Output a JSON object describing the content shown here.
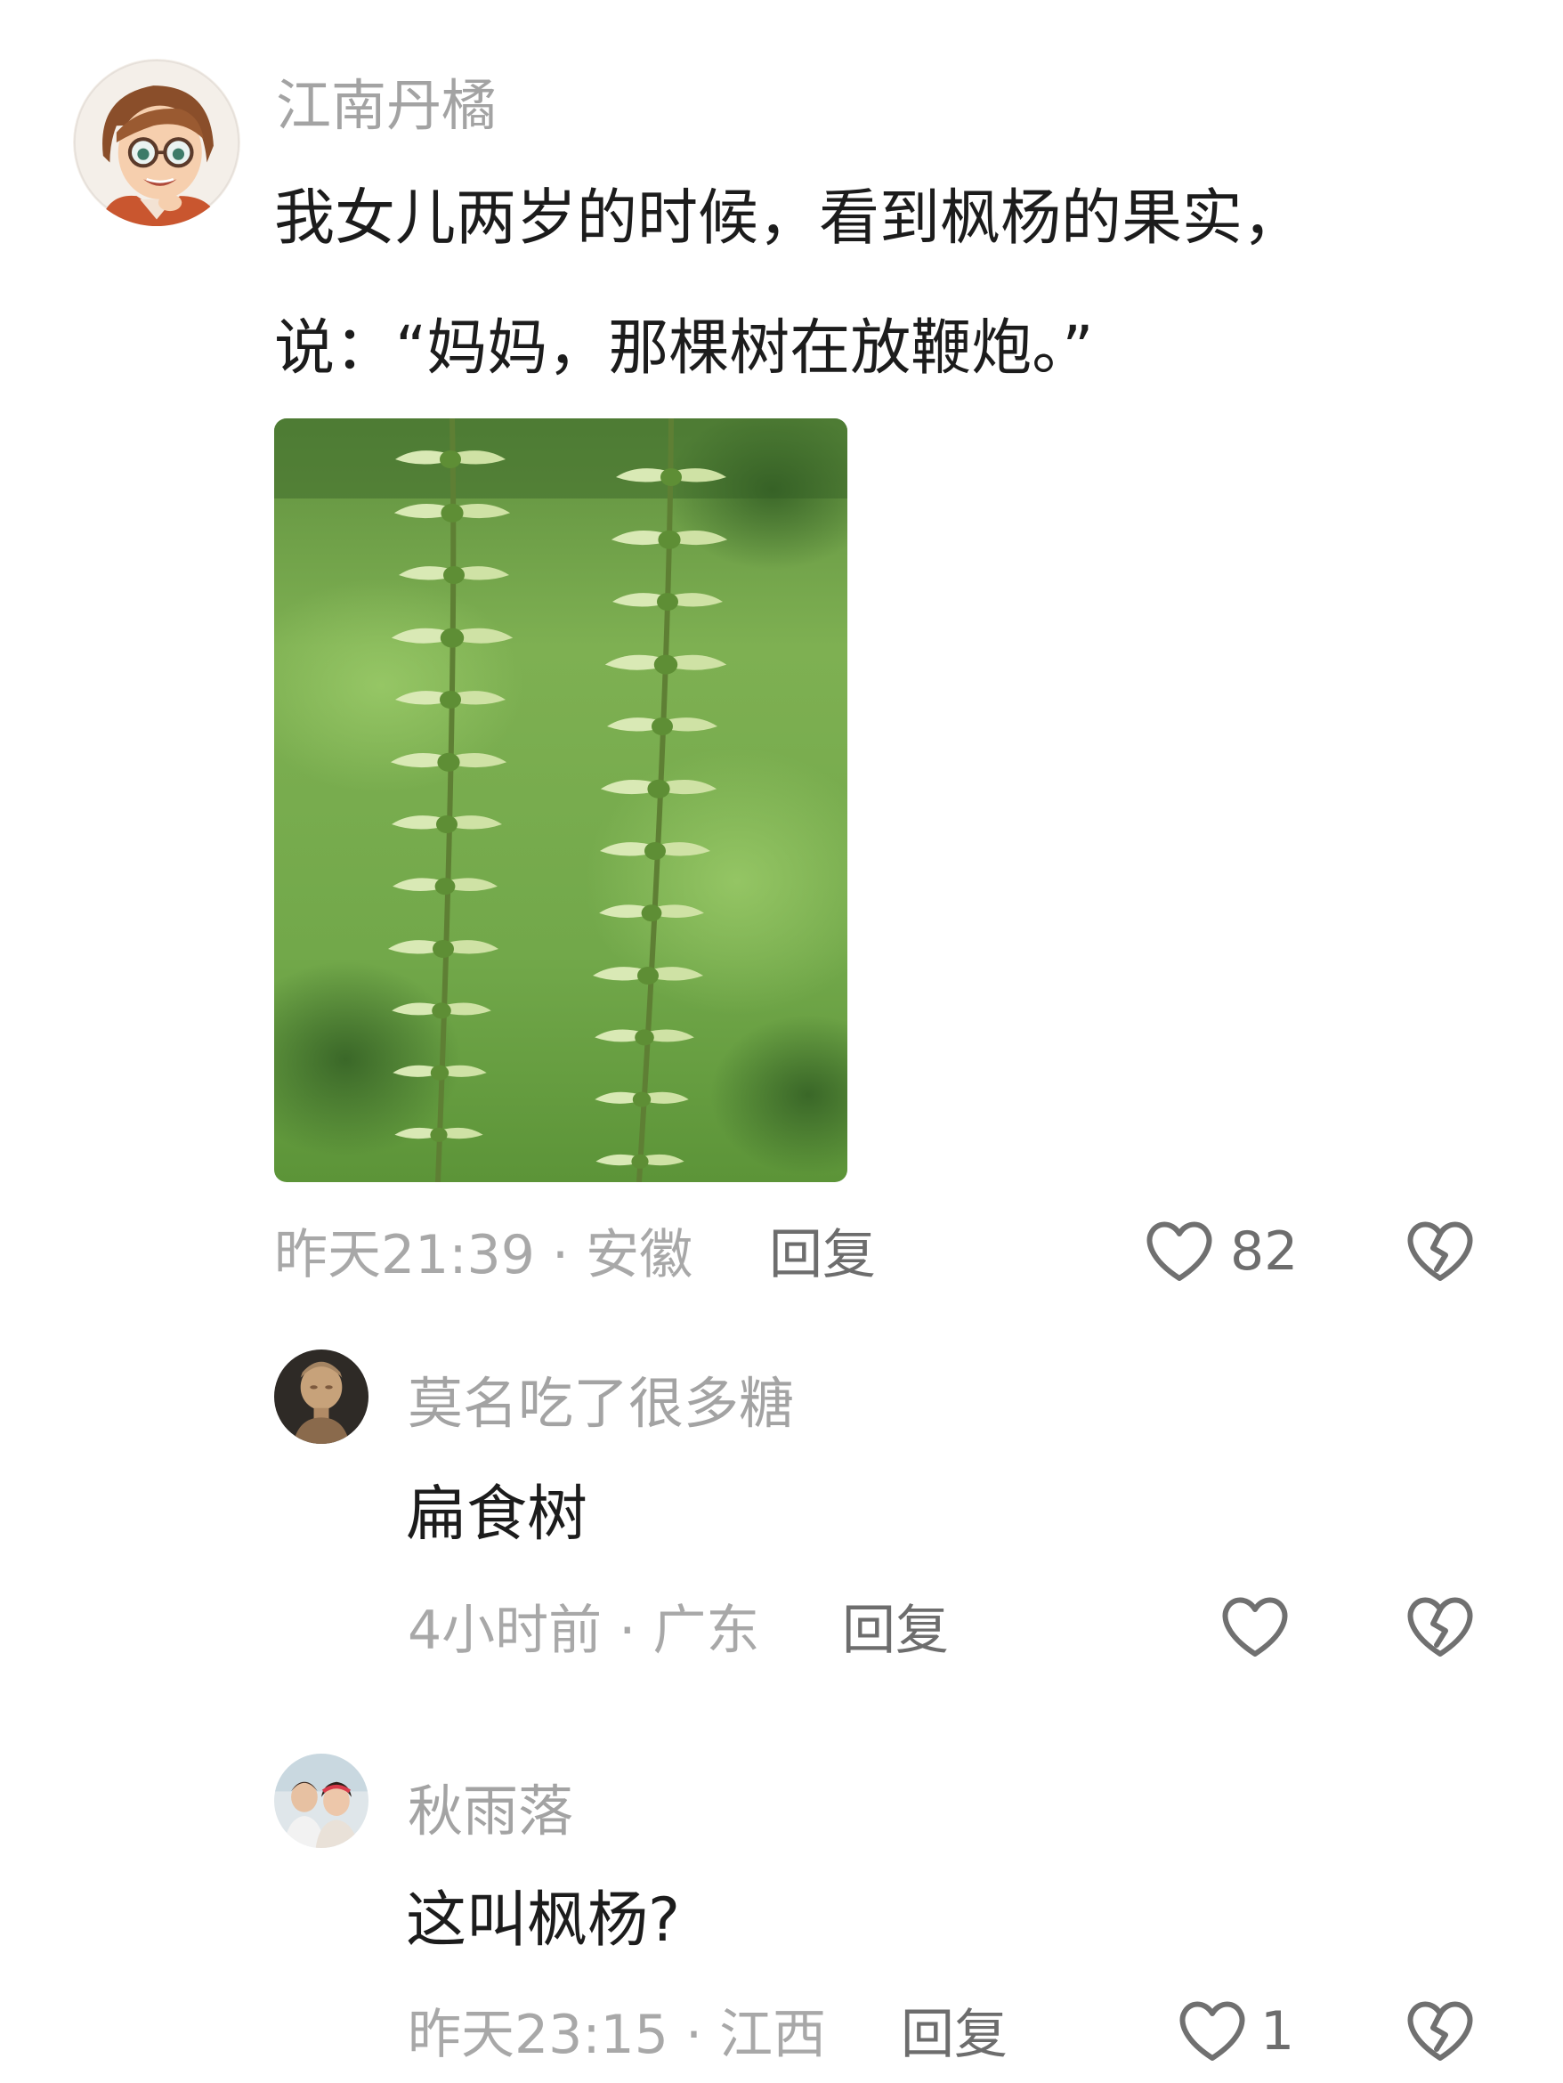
{
  "comments": [
    {
      "username": "江南丹橘",
      "text_line1": "我女儿两岁的时候，看到枫杨的果实，",
      "text_line2": "说：“妈妈，那棵树在放鞭炮。”",
      "meta": "昨天21:39 · 安徽",
      "reply_label": "回复",
      "likes": "82",
      "avatar_icon": "cartoon-woman-avatar",
      "image_icon": "maple-poplar-fruit-photo"
    },
    {
      "username": "莫名吃了很多糖",
      "text": "扁食树",
      "meta": "4小时前 · 广东",
      "reply_label": "回复",
      "likes": "",
      "avatar_icon": "statue-avatar"
    },
    {
      "username": "秋雨落",
      "text": "这叫枫杨?",
      "meta": "昨天23:15 · 江西",
      "reply_label": "回复",
      "likes": "1",
      "avatar_icon": "couple-photo-avatar"
    }
  ],
  "icons": {
    "like": "heart-outline-icon",
    "dislike": "broken-heart-icon"
  },
  "colors": {
    "username": "#a3a3a3",
    "meta": "#a8a8a8",
    "action": "#6d6d6d"
  }
}
